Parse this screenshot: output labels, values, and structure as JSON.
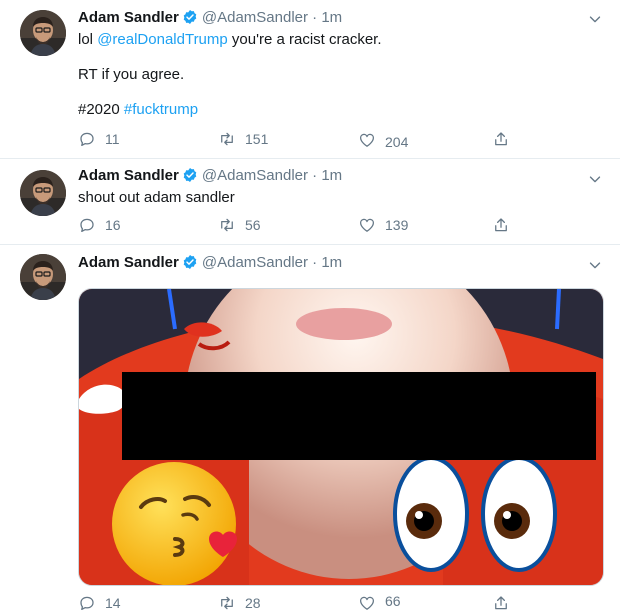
{
  "tweets": [
    {
      "name": "Adam Sandler",
      "handle": "@AdamSandler",
      "dot": "·",
      "time": "1m",
      "line1_pre": "lol ",
      "mention": "@realDonaldTrump",
      "line1_post": " you're a racist cracker.",
      "line2": "RT if you agree.",
      "tag1": "#2020",
      "tag2": "#fucktrump",
      "replies": "11",
      "retweets": "151",
      "likes": "204"
    },
    {
      "name": "Adam Sandler",
      "handle": "@AdamSandler",
      "dot": "·",
      "time": "1m",
      "text": "shout out adam sandler",
      "replies": "16",
      "retweets": "56",
      "likes": "139"
    },
    {
      "name": "Adam Sandler",
      "handle": "@AdamSandler",
      "dot": "·",
      "time": "1m",
      "replies": "14",
      "retweets": "28",
      "likes": "66"
    }
  ],
  "icons": {
    "verified": "verified-badge-icon",
    "reply": "reply-icon",
    "retweet": "retweet-icon",
    "like": "heart-icon",
    "share": "share-icon",
    "more": "chevron-down-icon"
  },
  "colors": {
    "link": "#1da1f2",
    "muted": "#657786",
    "verified": "#1da1f2"
  }
}
